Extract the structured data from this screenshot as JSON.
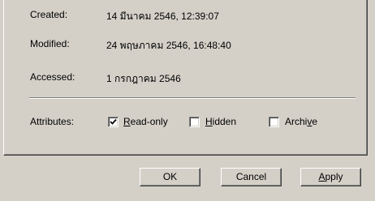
{
  "properties": {
    "created_label": "Created:",
    "created_value": "14 มีนาคม 2546, 12:39:07",
    "modified_label": "Modified:",
    "modified_value": "24 พฤษภาคม 2546, 16:48:40",
    "accessed_label": "Accessed:",
    "accessed_value": "1 กรกฎาคม 2546"
  },
  "attributes": {
    "label": "Attributes:",
    "readonly": {
      "pre": "",
      "key": "R",
      "post": "ead-only",
      "checked": true
    },
    "hidden": {
      "pre": "",
      "key": "H",
      "post": "idden",
      "checked": false
    },
    "archive": {
      "pre": "Archi",
      "key": "v",
      "post": "e",
      "checked": false
    }
  },
  "buttons": {
    "ok": "OK",
    "cancel": "Cancel",
    "apply": {
      "pre": "",
      "key": "A",
      "post": "pply"
    }
  },
  "icons": {
    "check": "checkmark-icon"
  }
}
